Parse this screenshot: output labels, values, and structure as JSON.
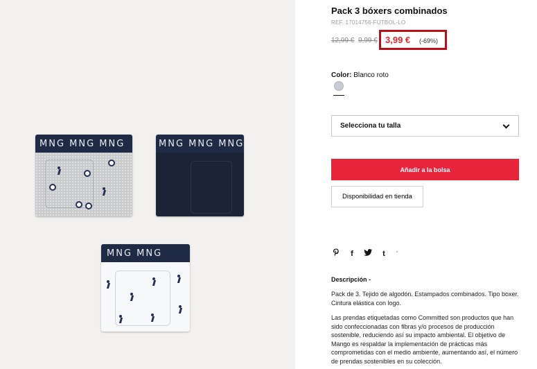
{
  "product": {
    "title": "Pack 3 bóxers combinados",
    "ref": "REF. 17014756-FUTBOL-LO",
    "original_price": "12,99 €",
    "previous_price": "9,99 €",
    "price": "3,99 €",
    "discount": "(-69%)",
    "highlight_color": "#b80f1b",
    "price_color": "#e0262d"
  },
  "image": {
    "brand": "MNG",
    "band_text_grey": "MNG    MNG    MNG",
    "band_text_navy": "MNG    MNG    MNG",
    "band_text_white": "MNG    MNG",
    "band_color": "#1f2a44"
  },
  "color": {
    "label": "Color:",
    "value": "Blanco roto",
    "swatch_color": "#c8cbd3"
  },
  "size_select": {
    "label": "Selecciona tu talla"
  },
  "add_to_bag": {
    "label": "Añadir a la bolsa",
    "color": "#e8243a"
  },
  "store_availability": {
    "label": "Disponibilidad en tienda"
  },
  "social": {
    "icons": [
      "pinterest-icon",
      "facebook-icon",
      "twitter-icon",
      "tumblr-icon"
    ],
    "glyphs": [
      "℗",
      "f",
      "🐦",
      "t"
    ],
    "extra": "'"
  },
  "description": {
    "title": "Descripción -",
    "paragraph1": "Pack de 3. Tejido de algodón. Estampados combinados. Tipo boxer. Cintura elástica con logo.",
    "paragraph2": "Las prendas etiquetadas como Committed son productos que han sido confeccionadas con fibras y/o procesos de producción sostenible, reduciendo así su impacto ambiental. El objetivo de Mango es respaldar la implementación de prácticas más comprometidas con el medio ambiente, aumentando así, el número de prendas sostenibles en su colección."
  }
}
